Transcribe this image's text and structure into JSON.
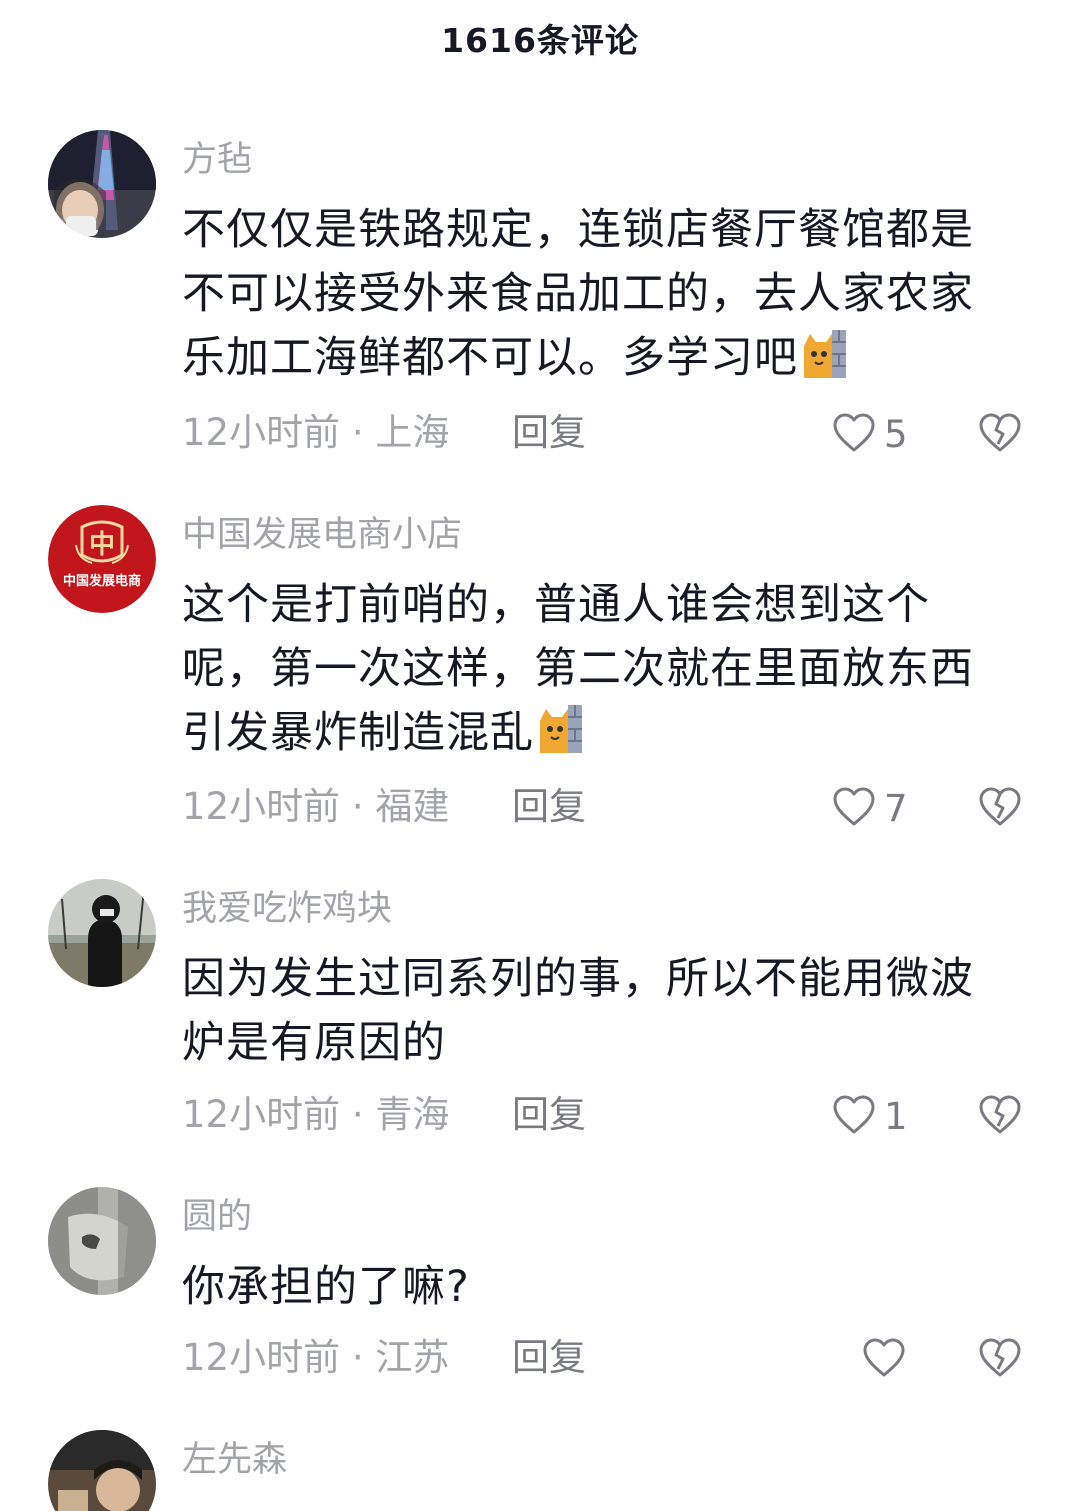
{
  "header": {
    "title": "1616条评论"
  },
  "comments": [
    {
      "username": "方毡",
      "text": "不仅仅是铁路规定，连锁店餐厅餐馆都是不可以接受外来食品加工的，去人家农家乐加工海鲜都不可以。多学习吧",
      "emoji": "cat-peek-emoji",
      "time": "12小时前",
      "location": "上海",
      "reply_label": "回复",
      "likes": "5"
    },
    {
      "username": "中国发展电商小店",
      "avatar_text": "中国发展电商",
      "avatar_char": "中",
      "text": "这个是打前哨的，普通人谁会想到这个呢，第一次这样，第二次就在里面放东西引发暴炸制造混乱",
      "emoji": "cat-peek-emoji",
      "time": "12小时前",
      "location": "福建",
      "reply_label": "回复",
      "likes": "7"
    },
    {
      "username": "我爱吃炸鸡块",
      "text": "因为发生过同系列的事，所以不能用微波炉是有原因的",
      "time": "12小时前",
      "location": "青海",
      "reply_label": "回复",
      "likes": "1"
    },
    {
      "username": "圆的",
      "text": "你承担的了嘛?",
      "time": "12小时前",
      "location": "江苏",
      "reply_label": "回复",
      "likes": ""
    },
    {
      "username": "左先森"
    }
  ],
  "colors": {
    "primary_text": "#161823",
    "secondary_text": "#a3a4a8",
    "icon": "#7a7b80",
    "brand_red": "#c0161c"
  },
  "icons": [
    "heart-outline-icon",
    "broken-heart-icon",
    "cat-peek-emoji"
  ]
}
